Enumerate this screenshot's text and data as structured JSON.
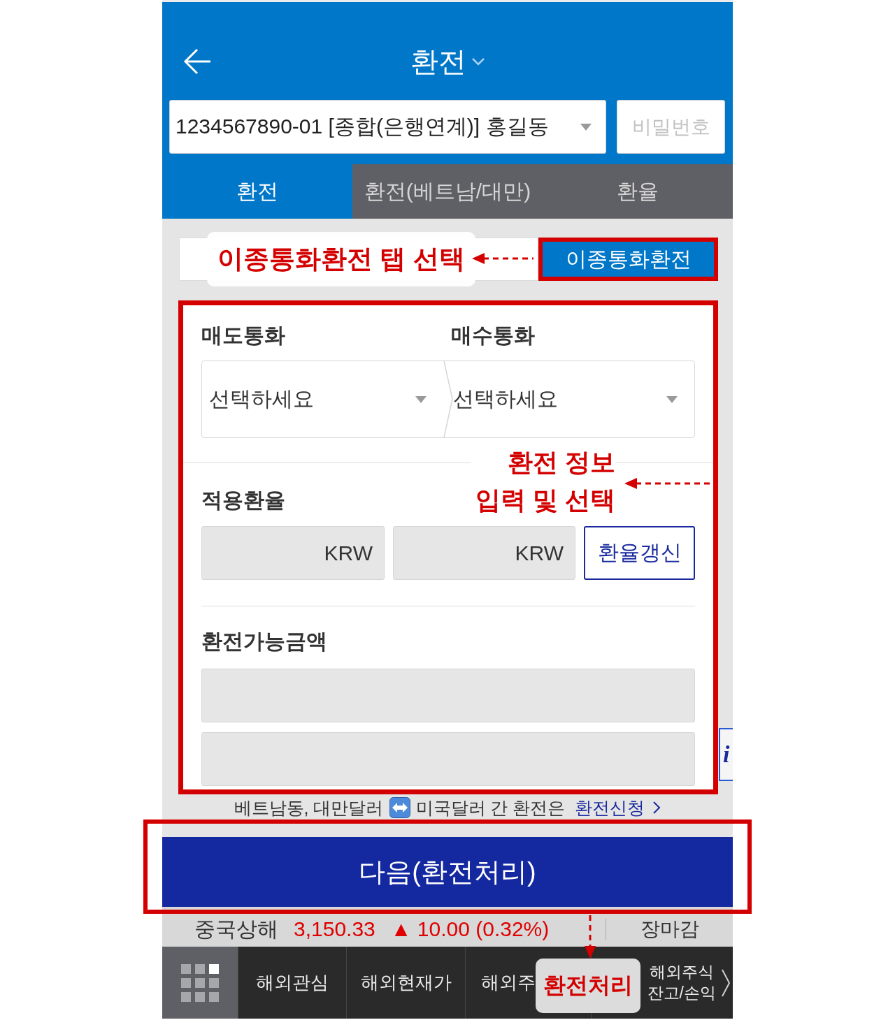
{
  "header": {
    "title": "환전"
  },
  "account": {
    "value": "1234567890-01 [종합(은행연계)] 홍길동",
    "password_placeholder": "비밀번호"
  },
  "tabs": [
    {
      "label": "환전",
      "selected": true
    },
    {
      "label": "환전(베트남/대만)",
      "selected": false
    },
    {
      "label": "환율",
      "selected": false
    }
  ],
  "sub_tabs": [
    {
      "label": "이종통화환전",
      "selected": true
    }
  ],
  "form": {
    "sell_label": "매도통화",
    "buy_label": "매수통화",
    "selects": [
      {
        "placeholder": "선택하세요"
      },
      {
        "placeholder": "선택하세요"
      }
    ],
    "rate_label": "적용환율",
    "rate_fields": [
      {
        "unit": "KRW",
        "disabled": true
      },
      {
        "unit": "KRW",
        "disabled": true
      }
    ],
    "refresh_button": "환율갱신",
    "amount_label": "환전가능금액",
    "amount_fields": [
      {
        "disabled": true
      },
      {
        "disabled": true
      }
    ]
  },
  "info_button": {
    "label": "i"
  },
  "notice": {
    "text_before_icon": "베트남동, 대만달러",
    "text_after_icon": "미국달러 간 환전은",
    "link": "환전신청"
  },
  "next_button": "다음(환전처리)",
  "ticker": {
    "name": "중국상해",
    "value": "3,150.33",
    "change": "▲ 10.00 (0.32%)",
    "rising": true,
    "status": "장마감"
  },
  "bottom_nav": {
    "items": [
      {
        "label": "해외관심"
      },
      {
        "label": "해외현재가"
      },
      {
        "label": "해외주"
      },
      {
        "label": "해외주식\n잔고/손익"
      }
    ]
  },
  "annotations": {
    "tab_callout": "이종통화환전 탭 선택",
    "form_callout": "환전 정보\n입력 및 선택",
    "button_callout": "환전처리"
  }
}
